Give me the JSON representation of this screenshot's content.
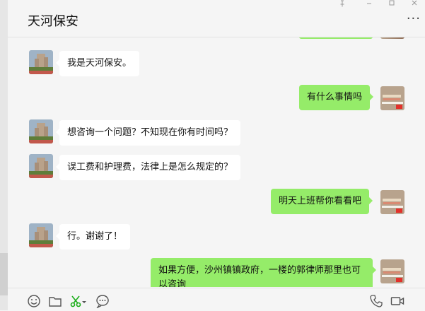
{
  "window": {
    "title": "天河保安"
  },
  "messages": [
    {
      "side": "left",
      "text": "我是天河保安。"
    },
    {
      "side": "right",
      "text": "有什么事情吗"
    },
    {
      "side": "left",
      "text": "想咨询一个问题？不知现在你有时间吗？"
    },
    {
      "side": "left",
      "text": "误工费和护理费，法律上是怎么规定的？"
    },
    {
      "side": "right",
      "text": "明天上班帮你看看吧"
    },
    {
      "side": "left",
      "text": "行。谢谢了！"
    },
    {
      "side": "right",
      "text": "如果方便，沙州镇镇政府，一楼的郭律师那里也可以咨询"
    }
  ],
  "toolbar": {
    "icons": [
      "emoji-icon",
      "folder-icon",
      "scissors-icon",
      "chat-history-icon",
      "phone-icon",
      "video-call-icon"
    ]
  }
}
